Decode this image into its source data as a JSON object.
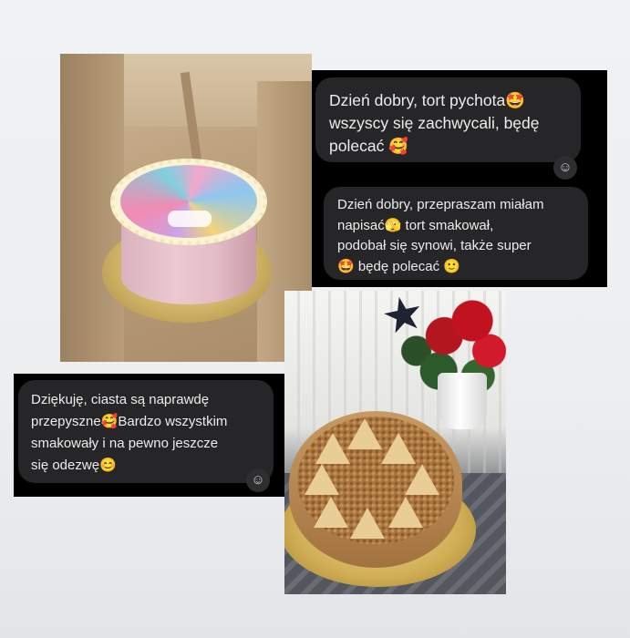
{
  "colors": {
    "background": "#eceef0",
    "chat_panel": "#000000",
    "bubble": "#262628",
    "bubble_text": "#ececec"
  },
  "messages": [
    {
      "text": "Dzień dobry, tort pychota🤩\nwszyscy się zachwycali, będę\npolecać 🥰"
    },
    {
      "text": "Dzień dobry, przepraszam miałam\nnapisać🫣 tort smakował,\npodobał się synowi, także super\n🤩 będę polecać 🙂"
    },
    {
      "text": "Dziękuję, ciasta są naprawdę\nprzepyszne🥰Bardzo wszystkim\nsmakowały i na pewno jeszcze\nsię odezwę😊"
    }
  ],
  "icons": {
    "reaction": "add-reaction-icon",
    "star": "star-decoration-icon"
  }
}
